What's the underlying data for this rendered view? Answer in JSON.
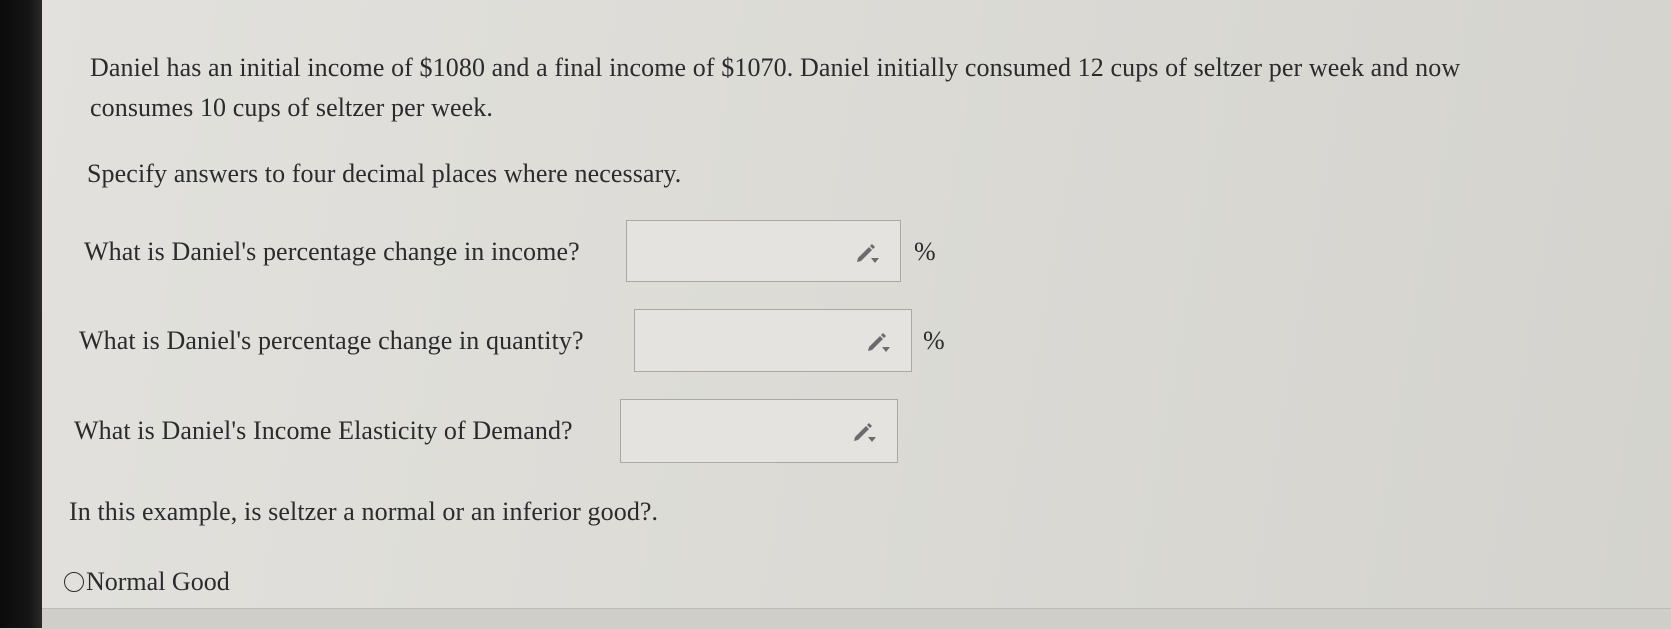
{
  "question": {
    "problem_line1": "Daniel has an initial income of $1080 and a final income of $1070. Daniel initially consumed 12 cups of seltzer per week and now",
    "problem_line2": "consumes 10 cups of seltzer per week.",
    "instructions": "Specify answers to four decimal places where necessary.",
    "parts": [
      {
        "prompt": "What is Daniel's percentage change in income?",
        "value": "",
        "unit": "%"
      },
      {
        "prompt": "What is Daniel's percentage change in quantity?",
        "value": "",
        "unit": "%"
      },
      {
        "prompt": "What is Daniel's Income Elasticity of Demand?",
        "value": "",
        "unit": ""
      }
    ],
    "good_type_prompt": "In this example, is seltzer a normal or an inferior good?.",
    "options": [
      {
        "label": "Normal Good",
        "selected": false
      }
    ]
  },
  "icons": {
    "answer_tool": "pencil-dropdown-icon",
    "option": "radio-circle-icon"
  },
  "colors": {
    "text": "#2b2b2e",
    "background": "#dcdbd6",
    "field_border": "#a9a8a3"
  }
}
